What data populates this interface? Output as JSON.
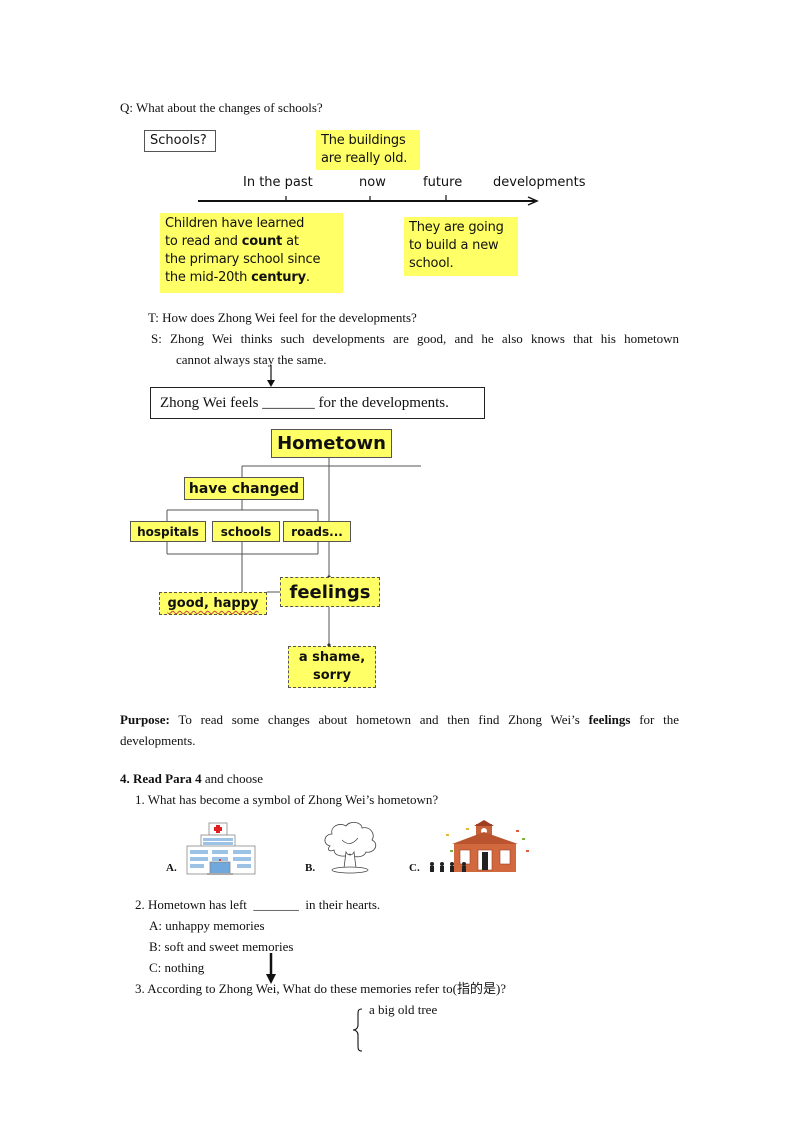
{
  "section1": {
    "question": "Q: What about the changes of schools?",
    "timeline": {
      "topic_label": "Schools?",
      "axis_labels": [
        "In the past",
        "now",
        "future",
        "developments"
      ],
      "notes": {
        "now": "The buildings are really old.",
        "now_lines": [
          "The buildings",
          "are really old."
        ],
        "past_lines": [
          {
            "pre": "Children have learned",
            "bold": "",
            "post": ""
          },
          {
            "pre": "to read and ",
            "bold": "count",
            "post": " at"
          },
          {
            "pre": "the primary school since",
            "bold": "",
            "post": ""
          },
          {
            "pre": "the mid-20th ",
            "bold": "century",
            "post": "."
          }
        ],
        "future_lines": [
          "They are going",
          "to build a new",
          "school."
        ]
      }
    },
    "teacher_q": "T: How does Zhong Wei feel for the developments?",
    "student_a_line1": "S: Zhong Wei thinks such developments are good, and he also knows that his hometown",
    "student_a_line2": "cannot always stay the same.",
    "fill_box": {
      "pre": "Zhong Wei feels",
      "blank": "_______",
      "post": "for the developments."
    }
  },
  "mindmap": {
    "root": "Hometown",
    "branch1": "have changed",
    "children": [
      "hospitals",
      "schools",
      "roads..."
    ],
    "feelings": "feelings",
    "positive": "good, happy",
    "negative_line1": "a shame,",
    "negative_line2": "sorry",
    "colors": {
      "node_fill": "#ffff66",
      "line": "#555555"
    }
  },
  "purpose": {
    "label": "Purpose:",
    "text_pre": " To read some changes about hometown and then find Zhong Wei’s ",
    "text_bold": "feelings",
    "text_post": " for the",
    "line2": "developments."
  },
  "section4": {
    "heading_bold": "4. Read Para 4",
    "heading_rest": " and choose",
    "q1": "1. What has become a symbol of Zhong Wei’s hometown?",
    "q1_options": [
      {
        "label": "A.",
        "icon": "hospital-icon"
      },
      {
        "label": "B.",
        "icon": "tree-icon"
      },
      {
        "label": "C.",
        "icon": "school-icon"
      }
    ],
    "q2": "2. Hometown has left",
    "q2_blank": "_______",
    "q2_post": "in their hearts.",
    "q2_options": [
      "A: unhappy memories",
      "B: soft and sweet memories",
      "C: nothing"
    ],
    "q3": "3. According to Zhong Wei, What do these memories refer to(指的是)?",
    "q3_answer": "a big old tree"
  }
}
